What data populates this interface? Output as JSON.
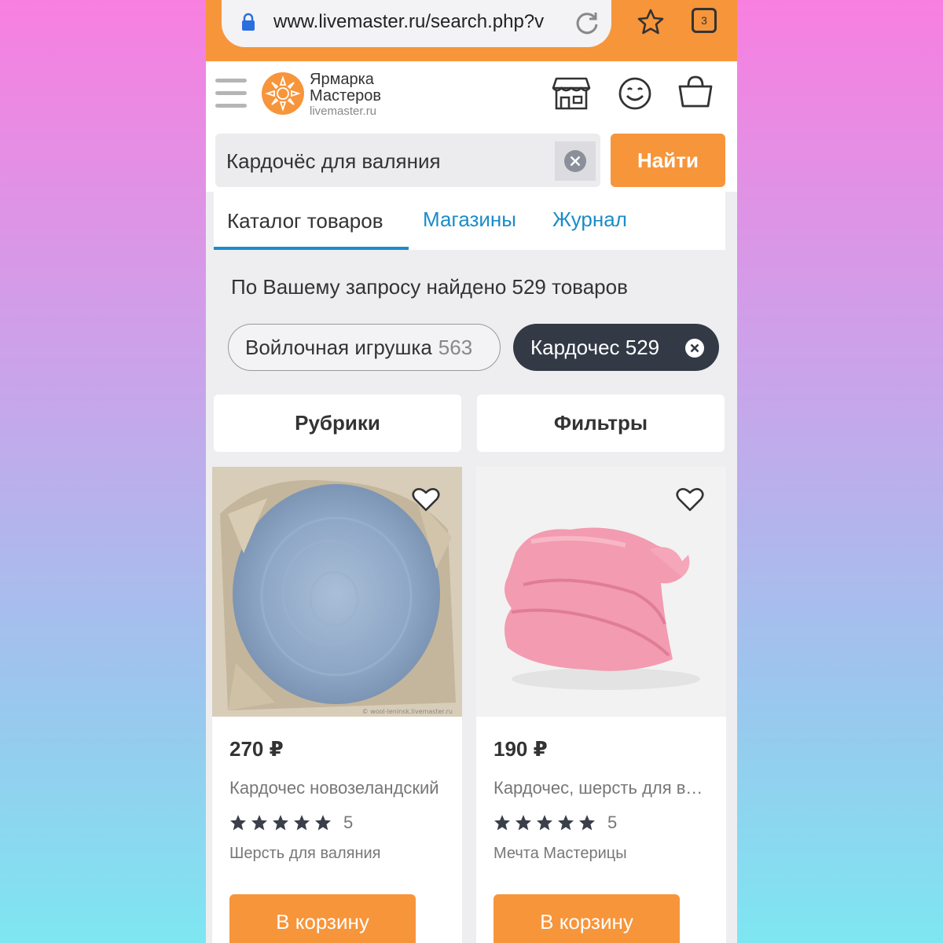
{
  "browser": {
    "url": "www.livemaster.ru/search.php?v",
    "tab_count": "3"
  },
  "header": {
    "logo_line1": "Ярмарка",
    "logo_line2": "Мастеров",
    "logo_domain": "livemaster.ru"
  },
  "search": {
    "query": "Кардочёс для валяния",
    "button_label": "Найти"
  },
  "tabs": [
    {
      "label": "Каталог товаров"
    },
    {
      "label": "Магазины"
    },
    {
      "label": "Журнал"
    }
  ],
  "results": {
    "summary": "По Вашему запросу найдено 529 товаров"
  },
  "chips": [
    {
      "label": "Войлочная игрушка",
      "count": "563"
    },
    {
      "label": "Кардочес 529"
    }
  ],
  "actions": {
    "rubrics": "Рубрики",
    "filters": "Фильтры"
  },
  "products": [
    {
      "price": "270 ₽",
      "title": "Кардочес новозеландский",
      "rating": "5",
      "stars": 5,
      "shop": "Шерсть для валяния",
      "cart_label": "В корзину",
      "watermark": "© wool-leninsk.livemaster.ru"
    },
    {
      "price": "190 ₽",
      "title": "Кардочес, шерсть для валяния",
      "rating": "5",
      "stars": 5,
      "shop": "Мечта Мастерицы",
      "cart_label": "В корзину"
    }
  ],
  "colors": {
    "accent_orange": "#f7953b",
    "link_blue": "#1b8cc9",
    "chip_dark": "#333a46"
  }
}
